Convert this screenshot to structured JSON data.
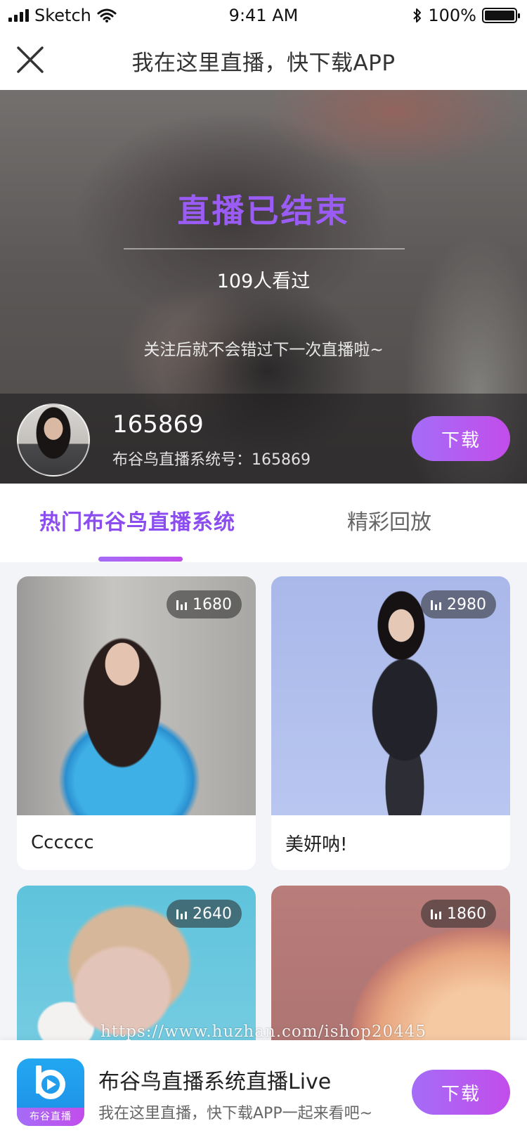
{
  "status_bar": {
    "carrier": "Sketch",
    "time": "9:41 AM",
    "battery": "100%",
    "battery_level": 1.0
  },
  "nav": {
    "title": "我在这里直播，快下载APP"
  },
  "hero": {
    "title": "直播已结束",
    "viewers": "109人看过",
    "tip": "关注后就不会错过下一次直播啦~",
    "host_name": "165869",
    "host_id": "布谷鸟直播系统号：165869",
    "download_label": "下载"
  },
  "tabs": [
    {
      "label": "热门布谷鸟直播系统",
      "active": true
    },
    {
      "label": "精彩回放",
      "active": false
    }
  ],
  "cards": [
    {
      "title": "Cccccc",
      "views": "1680"
    },
    {
      "title": "美妍呐!",
      "views": "2980"
    },
    {
      "title": "",
      "views": "2640"
    },
    {
      "title": "",
      "views": "1860"
    }
  ],
  "watermark": "https://www.huzhan.com/ishop20445",
  "banner": {
    "icon_label": "布谷直播",
    "title": "布谷鸟直播系统直播Live",
    "subtitle": "我在这里直播，快下载APP一起来看吧~",
    "download_label": "下载"
  },
  "colors": {
    "accent_purple": "#9b5cf6",
    "button_gradient_start": "#a56cf7",
    "button_gradient_end": "#c24dea",
    "app_icon_blue": "#1d8ee6"
  },
  "icons": {
    "signal": "signal-icon",
    "wifi": "wifi-icon",
    "bluetooth": "bluetooth-icon",
    "battery": "battery-icon",
    "close": "close-icon",
    "views": "bar-chart-icon",
    "app": "app-logo-icon"
  }
}
